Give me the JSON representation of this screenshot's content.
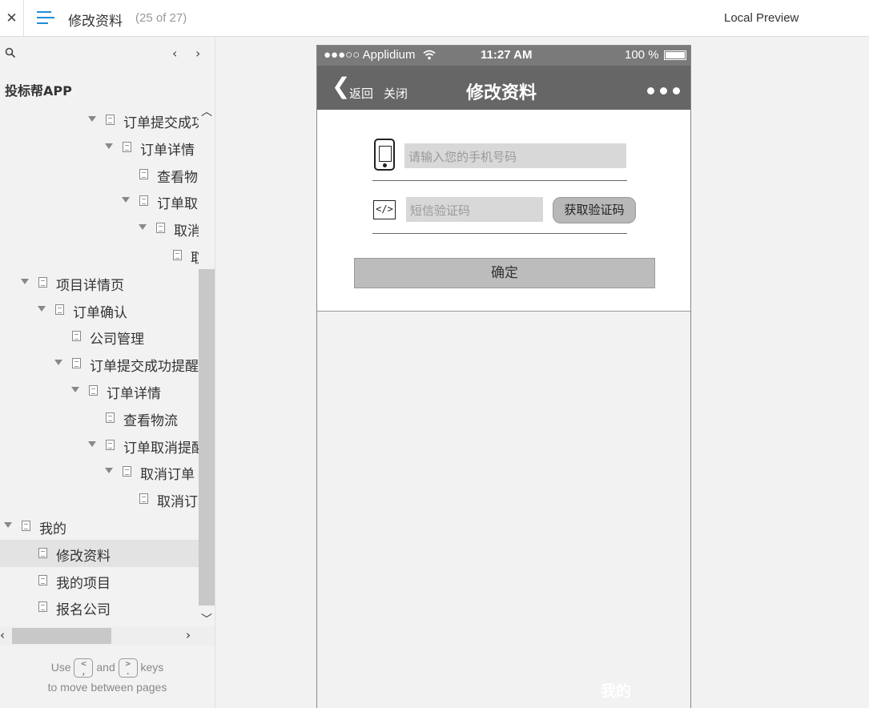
{
  "topbar": {
    "close_glyph": "✕",
    "title": "修改资料",
    "page_count": "(25 of 27)",
    "preview_label": "Local Preview",
    "accent_color": "#1d8fd8"
  },
  "sidebar": {
    "search_icon": "search-icon",
    "prev_glyph": "‹",
    "next_glyph": "›",
    "project_name": "投标帮APP",
    "tree": [
      {
        "label": "订单提交成功",
        "level": 5,
        "expanded": true
      },
      {
        "label": "订单详情",
        "level": 6,
        "expanded": true
      },
      {
        "label": "查看物流",
        "level": 7,
        "expanded": null
      },
      {
        "label": "订单取消提醒",
        "level": 7,
        "expanded": true
      },
      {
        "label": "取消订单",
        "level": 8,
        "expanded": true
      },
      {
        "label": "取消订单",
        "level": 9,
        "expanded": null
      },
      {
        "label": "项目详情页",
        "level": 1,
        "expanded": true
      },
      {
        "label": "订单确认",
        "level": 2,
        "expanded": true
      },
      {
        "label": "公司管理",
        "level": 3,
        "expanded": null
      },
      {
        "label": "订单提交成功提醒",
        "level": 3,
        "expanded": true
      },
      {
        "label": "订单详情",
        "level": 4,
        "expanded": true
      },
      {
        "label": "查看物流",
        "level": 5,
        "expanded": null
      },
      {
        "label": "订单取消提醒",
        "level": 5,
        "expanded": true
      },
      {
        "label": "取消订单",
        "level": 6,
        "expanded": true
      },
      {
        "label": "取消订单",
        "level": 7,
        "expanded": null
      },
      {
        "label": "我的",
        "level": 0,
        "expanded": true
      },
      {
        "label": "修改资料",
        "level": 1,
        "expanded": null,
        "selected": true
      },
      {
        "label": "我的项目",
        "level": 1,
        "expanded": null
      },
      {
        "label": "报名公司",
        "level": 1,
        "expanded": null
      }
    ],
    "hint": {
      "use": "Use",
      "and": "and",
      "keys": "keys",
      "line2": "to move between pages",
      "prev_key": "<\n,",
      "next_key": ">\n."
    }
  },
  "phone": {
    "status": {
      "carrier": "●●●○○ Applidium",
      "time": "11:27 AM",
      "battery": "100 %"
    },
    "nav": {
      "back_glyph": "❮",
      "back_label": "返回",
      "close_label": "关闭",
      "title": "修改资料"
    },
    "form": {
      "phone_placeholder": "请输入您的手机号码",
      "code_placeholder": "短信验证码",
      "get_code_label": "获取验证码",
      "confirm_label": "确定"
    },
    "bottom_label": "我的"
  }
}
